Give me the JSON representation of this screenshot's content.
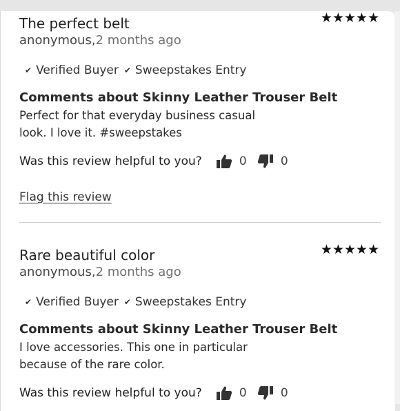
{
  "reviews": [
    {
      "title": "The perfect belt",
      "stars": "★★★★★",
      "author": "anonymous,",
      "date": "2 months ago",
      "badges": [
        "Verified Buyer",
        "Sweepstakes Entry"
      ],
      "comments_heading": "Comments about Skinny Leather Trouser Belt",
      "comment": "Perfect for that everyday business casual look. I love it. #sweepstakes",
      "helpful_label": "Was this review helpful to you?",
      "helpful_yes": "0",
      "helpful_no": "0",
      "flag_label": "Flag this review"
    },
    {
      "title": "Rare beautiful color",
      "stars": "★★★★★",
      "author": "anonymous,",
      "date": "2 months ago",
      "badges": [
        "Verified Buyer",
        "Sweepstakes Entry"
      ],
      "comments_heading": "Comments about Skinny Leather Trouser Belt",
      "comment": "I love accessories. This one in particular because of the rare color.",
      "helpful_label": "Was this review helpful to you?",
      "helpful_yes": "0",
      "helpful_no": "0"
    }
  ],
  "icons": {
    "check": "check-icon",
    "thumbs_up": "thumbs-up-icon",
    "thumbs_down": "thumbs-down-icon",
    "star": "star-icon"
  }
}
